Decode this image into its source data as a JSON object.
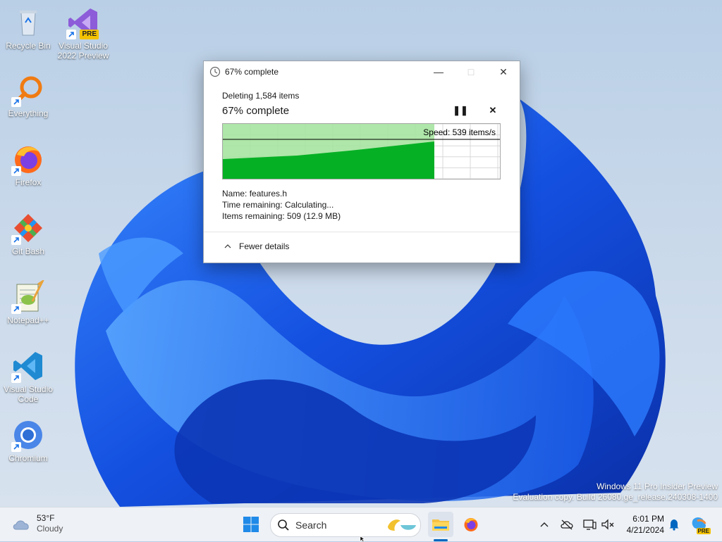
{
  "desktop": {
    "icons": [
      {
        "label": "Recycle Bin",
        "icon": "recycle-bin-icon"
      },
      {
        "label": "Visual Studio 2022 Preview",
        "icon": "visual-studio-preview-icon",
        "badge": "PRE"
      },
      {
        "label": "Everything",
        "icon": "everything-search-icon"
      },
      {
        "label": "Firefox",
        "icon": "firefox-icon"
      },
      {
        "label": "Git Bash",
        "icon": "git-bash-icon"
      },
      {
        "label": "Notepad++",
        "icon": "notepad-plus-plus-icon"
      },
      {
        "label": "Visual Studio Code",
        "icon": "vscode-icon"
      },
      {
        "label": "Chromium",
        "icon": "chromium-icon"
      }
    ]
  },
  "dialog": {
    "title": "67% complete",
    "operation": "Deleting 1,584 items",
    "percent_text": "67% complete",
    "progress": 0.67,
    "speed": "Speed: 539 items/s",
    "name_label": "Name:",
    "name_value": "features.h",
    "time_label": "Time remaining:",
    "time_value": "Calculating...",
    "items_label": "Items remaining:",
    "items_value": "509 (12.9 MB)",
    "fewer_details": "Fewer details",
    "colors": {
      "fill": "#06b025",
      "fill_light": "#a6e3a0"
    }
  },
  "taskbar": {
    "weather_temp": "53°F",
    "weather_desc": "Cloudy",
    "search_label": "Search",
    "time": "6:01 PM",
    "date": "4/21/2024",
    "copilot_badge": "PRE"
  },
  "watermark": {
    "line1": "Windows 11 Pro Insider Preview",
    "line2": "Evaluation copy. Build 26080.ge_release.240308-1400"
  }
}
